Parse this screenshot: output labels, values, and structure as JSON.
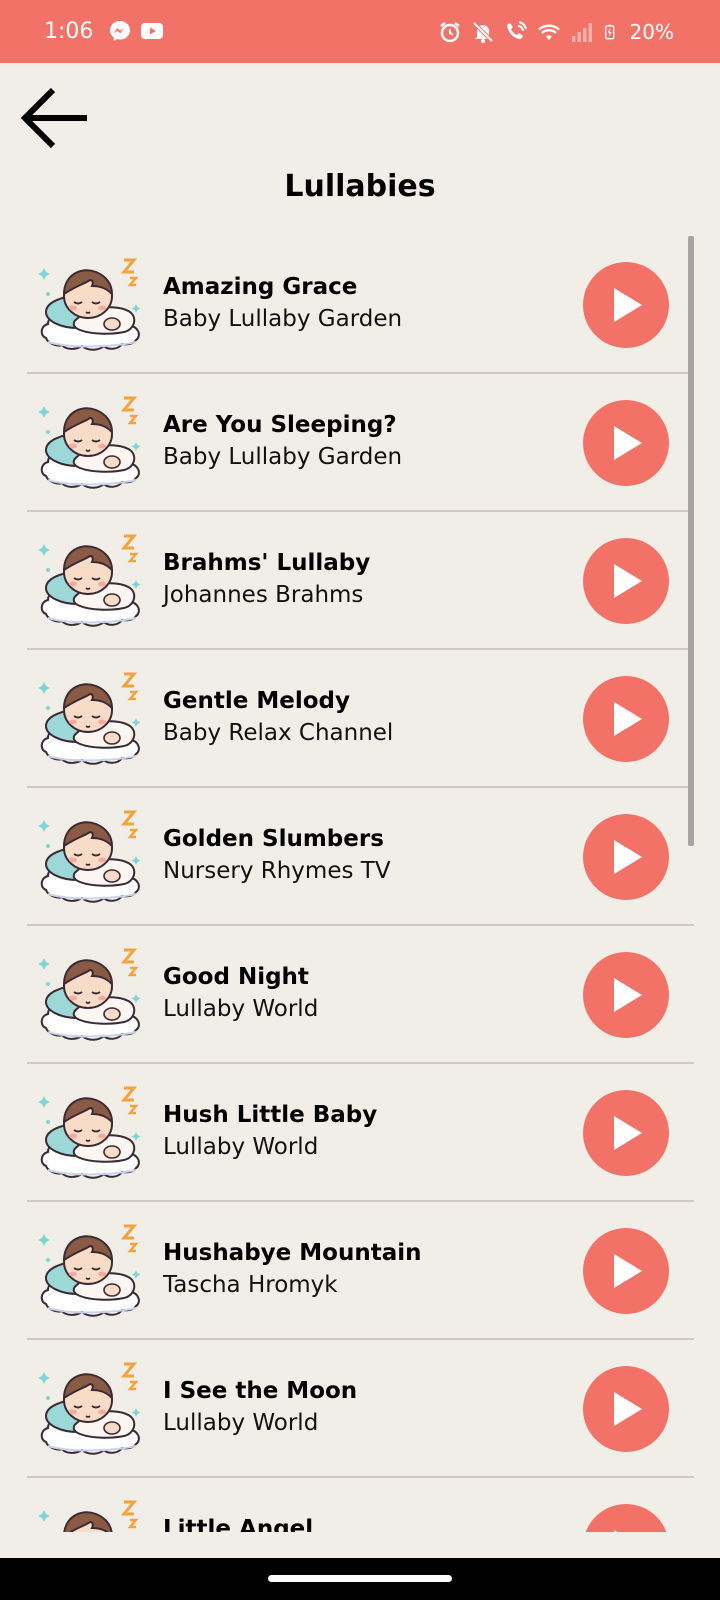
{
  "status_bar": {
    "time": "1:06",
    "battery": "20%",
    "left_icons": [
      "messenger-icon",
      "youtube-icon"
    ],
    "right_icons": [
      "alarm-icon",
      "notifications-off-icon",
      "wifi-calling-icon",
      "wifi-icon",
      "signal-icon",
      "battery-charging-icon"
    ]
  },
  "header": {
    "back_icon": "arrow-left-icon",
    "title": "Lullabies"
  },
  "songs": [
    {
      "title": "Amazing Grace",
      "artist": "Baby Lullaby Garden"
    },
    {
      "title": "Are You Sleeping?",
      "artist": "Baby Lullaby Garden"
    },
    {
      "title": "Brahms' Lullaby",
      "artist": "Johannes Brahms"
    },
    {
      "title": "Gentle Melody",
      "artist": "Baby Relax Channel"
    },
    {
      "title": "Golden Slumbers",
      "artist": "Nursery Rhymes TV"
    },
    {
      "title": "Good Night",
      "artist": "Lullaby World"
    },
    {
      "title": "Hush Little Baby",
      "artist": "Lullaby World"
    },
    {
      "title": "Hushabye Mountain",
      "artist": "Tascha Hromyk"
    },
    {
      "title": "I See the Moon",
      "artist": "Lullaby World"
    },
    {
      "title": "Little Angel",
      "artist": ""
    }
  ],
  "colors": {
    "accent": "#f37268",
    "background": "#f1eee7",
    "divider": "#cfcbc4"
  }
}
